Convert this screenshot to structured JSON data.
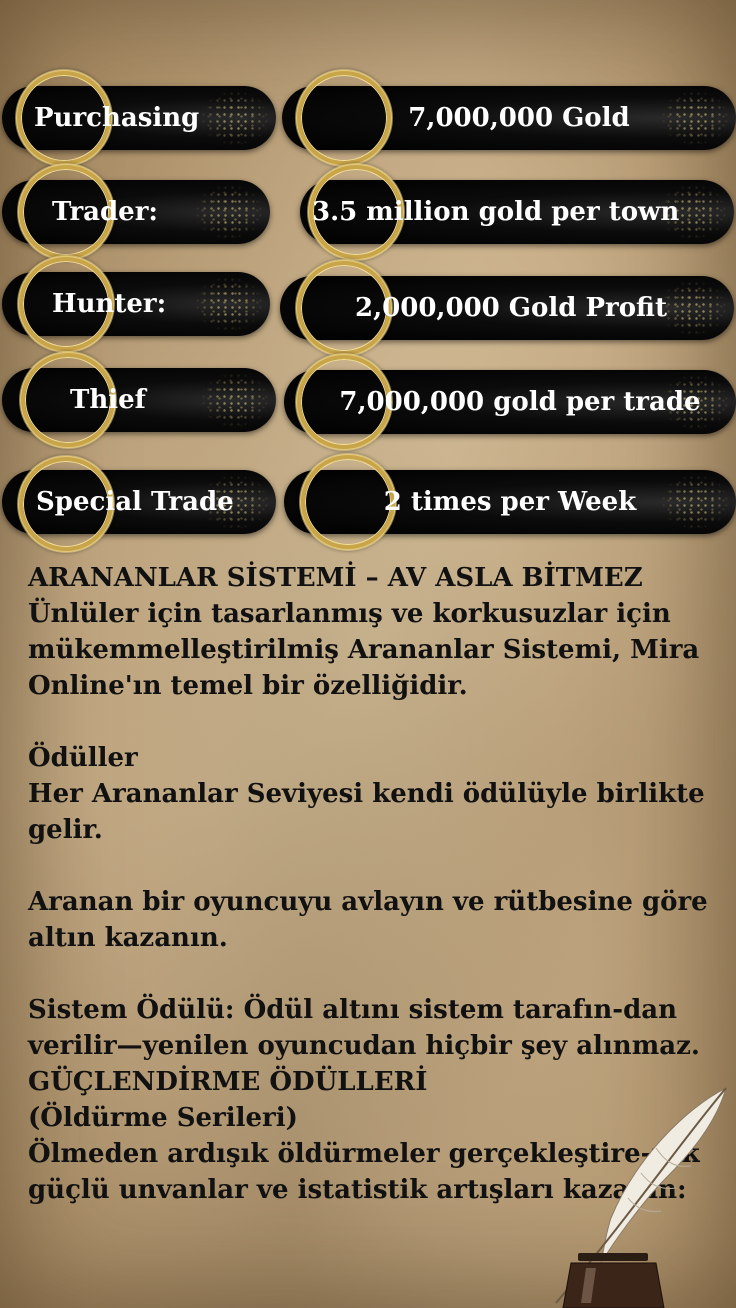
{
  "rows": [
    {
      "label": "Purchasing",
      "value": "7,000,000 Gold"
    },
    {
      "label": "Trader:",
      "value": "3.5 million gold per town"
    },
    {
      "label": "Hunter:",
      "value": "2,000,000 Gold Profit"
    },
    {
      "label": "Thief",
      "value": "7,000,000 gold per trade"
    },
    {
      "label": "Special Trade",
      "value": "2 times per Week"
    }
  ],
  "article": {
    "heading": "ARANANLAR SİSTEMİ – AV ASLA BİTMEZ",
    "intro": "Ünlüler için tasarlanmış ve korkusuzlar için mükemmelleştirilmiş Arananlar Sistemi, Mira Online'ın temel bir özelliğidir.",
    "rewards_title": "Ödüller",
    "rewards_text": "Her Arananlar Seviyesi kendi ödülüyle birlikte gelir.",
    "hunt_text": "Aranan bir oyuncuyu avlayın ve rütbesine göre altın kazanın.",
    "system_text": "Sistem Ödülü: Ödül altını sistem tarafın-dan verilir—yenilen oyuncudan hiçbir şey alınmaz. GÜÇLENDİRME ÖDÜLLERİ",
    "streak_title": "(Öldürme Serileri)",
    "streak_text": "Ölmeden ardışık öldürmeler gerçekleştire-rek güçlü unvanlar ve istatistik artışları kazanın:"
  },
  "decor": {
    "quill_icon": "quill-inkwell-icon",
    "ring_color": "#c9a54a",
    "pill_color": "#000000"
  }
}
